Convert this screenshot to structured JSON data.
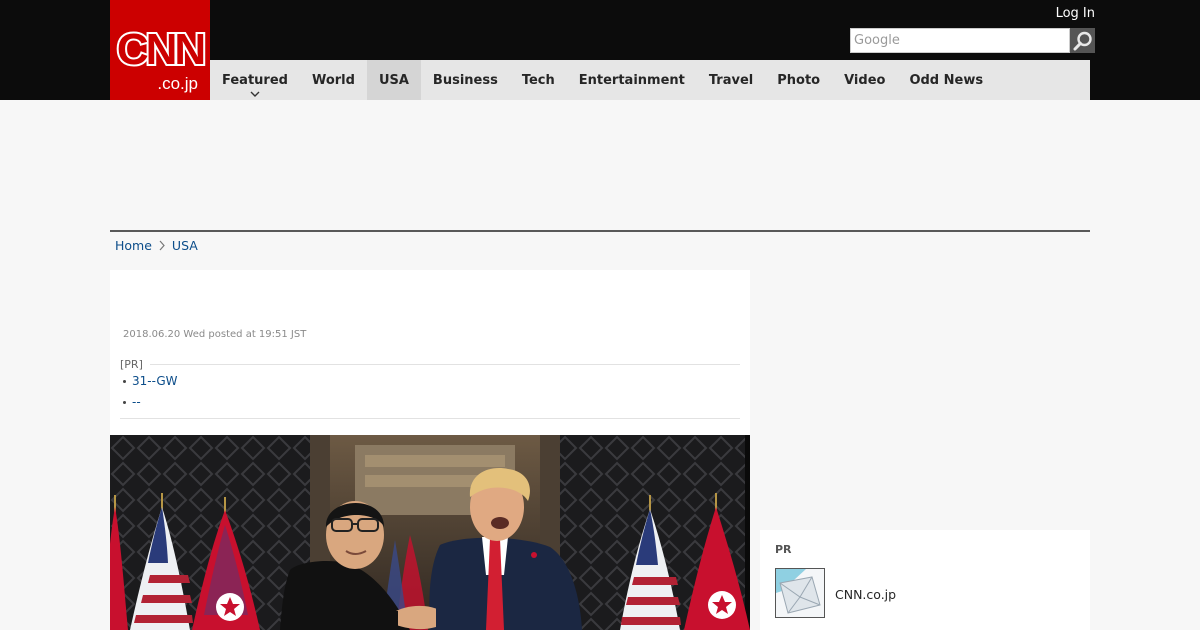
{
  "header": {
    "logo_text": "CNN",
    "logo_subtext": ".co.jp",
    "login_label": "Log In",
    "search_placeholder": "Google"
  },
  "nav": {
    "items": [
      {
        "label": "Featured",
        "has_dropdown": true,
        "active": false
      },
      {
        "label": "World",
        "active": false
      },
      {
        "label": "USA",
        "active": true
      },
      {
        "label": "Business",
        "active": false
      },
      {
        "label": "Tech",
        "active": false
      },
      {
        "label": "Entertainment",
        "active": false
      },
      {
        "label": "Travel",
        "active": false
      },
      {
        "label": "Photo",
        "active": false
      },
      {
        "label": "Video",
        "active": false
      },
      {
        "label": "Odd News",
        "active": false
      }
    ]
  },
  "breadcrumb": {
    "home": "Home",
    "section": "USA"
  },
  "article": {
    "dateline": "2018.06.20 Wed posted at 19:51 JST",
    "pr_label": "[PR]",
    "pr_links": [
      "31--GW",
      "--"
    ]
  },
  "sidebar": {
    "pr_label": "PR",
    "item_text": "CNN.co.jp"
  },
  "colors": {
    "brand_red": "#cc0000",
    "topbar": "#0c0c0c",
    "nav_bg": "#e6e6e6",
    "link": "#0c4d8a"
  },
  "icons": {
    "search": "search-icon",
    "breadcrumb_separator": "chevron-right-icon",
    "dropdown": "chevron-down-icon"
  }
}
